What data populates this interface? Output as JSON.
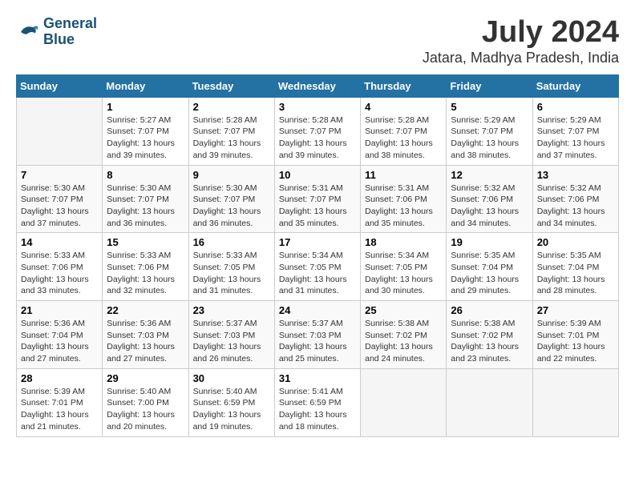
{
  "logo": {
    "line1": "General",
    "line2": "Blue"
  },
  "title": "July 2024",
  "location": "Jatara, Madhya Pradesh, India",
  "weekdays": [
    "Sunday",
    "Monday",
    "Tuesday",
    "Wednesday",
    "Thursday",
    "Friday",
    "Saturday"
  ],
  "weeks": [
    [
      {
        "day": "",
        "sunrise": "",
        "sunset": "",
        "daylight": ""
      },
      {
        "day": "1",
        "sunrise": "Sunrise: 5:27 AM",
        "sunset": "Sunset: 7:07 PM",
        "daylight": "Daylight: 13 hours and 39 minutes."
      },
      {
        "day": "2",
        "sunrise": "Sunrise: 5:28 AM",
        "sunset": "Sunset: 7:07 PM",
        "daylight": "Daylight: 13 hours and 39 minutes."
      },
      {
        "day": "3",
        "sunrise": "Sunrise: 5:28 AM",
        "sunset": "Sunset: 7:07 PM",
        "daylight": "Daylight: 13 hours and 39 minutes."
      },
      {
        "day": "4",
        "sunrise": "Sunrise: 5:28 AM",
        "sunset": "Sunset: 7:07 PM",
        "daylight": "Daylight: 13 hours and 38 minutes."
      },
      {
        "day": "5",
        "sunrise": "Sunrise: 5:29 AM",
        "sunset": "Sunset: 7:07 PM",
        "daylight": "Daylight: 13 hours and 38 minutes."
      },
      {
        "day": "6",
        "sunrise": "Sunrise: 5:29 AM",
        "sunset": "Sunset: 7:07 PM",
        "daylight": "Daylight: 13 hours and 37 minutes."
      }
    ],
    [
      {
        "day": "7",
        "sunrise": "Sunrise: 5:30 AM",
        "sunset": "Sunset: 7:07 PM",
        "daylight": "Daylight: 13 hours and 37 minutes."
      },
      {
        "day": "8",
        "sunrise": "Sunrise: 5:30 AM",
        "sunset": "Sunset: 7:07 PM",
        "daylight": "Daylight: 13 hours and 36 minutes."
      },
      {
        "day": "9",
        "sunrise": "Sunrise: 5:30 AM",
        "sunset": "Sunset: 7:07 PM",
        "daylight": "Daylight: 13 hours and 36 minutes."
      },
      {
        "day": "10",
        "sunrise": "Sunrise: 5:31 AM",
        "sunset": "Sunset: 7:07 PM",
        "daylight": "Daylight: 13 hours and 35 minutes."
      },
      {
        "day": "11",
        "sunrise": "Sunrise: 5:31 AM",
        "sunset": "Sunset: 7:06 PM",
        "daylight": "Daylight: 13 hours and 35 minutes."
      },
      {
        "day": "12",
        "sunrise": "Sunrise: 5:32 AM",
        "sunset": "Sunset: 7:06 PM",
        "daylight": "Daylight: 13 hours and 34 minutes."
      },
      {
        "day": "13",
        "sunrise": "Sunrise: 5:32 AM",
        "sunset": "Sunset: 7:06 PM",
        "daylight": "Daylight: 13 hours and 34 minutes."
      }
    ],
    [
      {
        "day": "14",
        "sunrise": "Sunrise: 5:33 AM",
        "sunset": "Sunset: 7:06 PM",
        "daylight": "Daylight: 13 hours and 33 minutes."
      },
      {
        "day": "15",
        "sunrise": "Sunrise: 5:33 AM",
        "sunset": "Sunset: 7:06 PM",
        "daylight": "Daylight: 13 hours and 32 minutes."
      },
      {
        "day": "16",
        "sunrise": "Sunrise: 5:33 AM",
        "sunset": "Sunset: 7:05 PM",
        "daylight": "Daylight: 13 hours and 31 minutes."
      },
      {
        "day": "17",
        "sunrise": "Sunrise: 5:34 AM",
        "sunset": "Sunset: 7:05 PM",
        "daylight": "Daylight: 13 hours and 31 minutes."
      },
      {
        "day": "18",
        "sunrise": "Sunrise: 5:34 AM",
        "sunset": "Sunset: 7:05 PM",
        "daylight": "Daylight: 13 hours and 30 minutes."
      },
      {
        "day": "19",
        "sunrise": "Sunrise: 5:35 AM",
        "sunset": "Sunset: 7:04 PM",
        "daylight": "Daylight: 13 hours and 29 minutes."
      },
      {
        "day": "20",
        "sunrise": "Sunrise: 5:35 AM",
        "sunset": "Sunset: 7:04 PM",
        "daylight": "Daylight: 13 hours and 28 minutes."
      }
    ],
    [
      {
        "day": "21",
        "sunrise": "Sunrise: 5:36 AM",
        "sunset": "Sunset: 7:04 PM",
        "daylight": "Daylight: 13 hours and 27 minutes."
      },
      {
        "day": "22",
        "sunrise": "Sunrise: 5:36 AM",
        "sunset": "Sunset: 7:03 PM",
        "daylight": "Daylight: 13 hours and 27 minutes."
      },
      {
        "day": "23",
        "sunrise": "Sunrise: 5:37 AM",
        "sunset": "Sunset: 7:03 PM",
        "daylight": "Daylight: 13 hours and 26 minutes."
      },
      {
        "day": "24",
        "sunrise": "Sunrise: 5:37 AM",
        "sunset": "Sunset: 7:03 PM",
        "daylight": "Daylight: 13 hours and 25 minutes."
      },
      {
        "day": "25",
        "sunrise": "Sunrise: 5:38 AM",
        "sunset": "Sunset: 7:02 PM",
        "daylight": "Daylight: 13 hours and 24 minutes."
      },
      {
        "day": "26",
        "sunrise": "Sunrise: 5:38 AM",
        "sunset": "Sunset: 7:02 PM",
        "daylight": "Daylight: 13 hours and 23 minutes."
      },
      {
        "day": "27",
        "sunrise": "Sunrise: 5:39 AM",
        "sunset": "Sunset: 7:01 PM",
        "daylight": "Daylight: 13 hours and 22 minutes."
      }
    ],
    [
      {
        "day": "28",
        "sunrise": "Sunrise: 5:39 AM",
        "sunset": "Sunset: 7:01 PM",
        "daylight": "Daylight: 13 hours and 21 minutes."
      },
      {
        "day": "29",
        "sunrise": "Sunrise: 5:40 AM",
        "sunset": "Sunset: 7:00 PM",
        "daylight": "Daylight: 13 hours and 20 minutes."
      },
      {
        "day": "30",
        "sunrise": "Sunrise: 5:40 AM",
        "sunset": "Sunset: 6:59 PM",
        "daylight": "Daylight: 13 hours and 19 minutes."
      },
      {
        "day": "31",
        "sunrise": "Sunrise: 5:41 AM",
        "sunset": "Sunset: 6:59 PM",
        "daylight": "Daylight: 13 hours and 18 minutes."
      },
      {
        "day": "",
        "sunrise": "",
        "sunset": "",
        "daylight": ""
      },
      {
        "day": "",
        "sunrise": "",
        "sunset": "",
        "daylight": ""
      },
      {
        "day": "",
        "sunrise": "",
        "sunset": "",
        "daylight": ""
      }
    ]
  ]
}
